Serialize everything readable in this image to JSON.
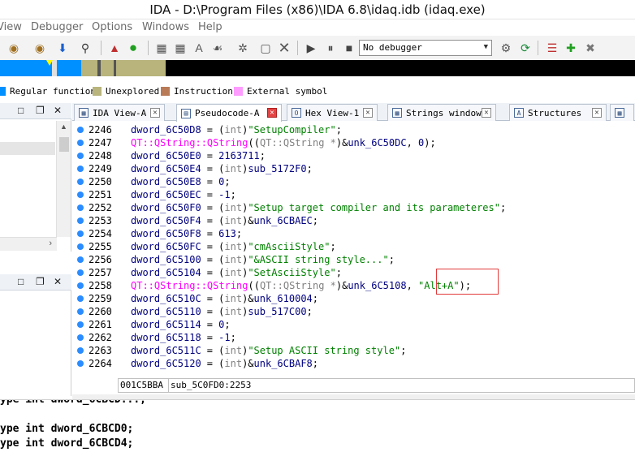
{
  "window": {
    "title": "IDA - D:\\Program Files (x86)\\IDA 6.8\\idaq.idb (idaq.exe)"
  },
  "menu": [
    "View",
    "Debugger",
    "Options",
    "Windows",
    "Help"
  ],
  "toolbar": {
    "debugger_select": "No debugger"
  },
  "legend": [
    {
      "label": "Regular function",
      "color": "#0090ff"
    },
    {
      "label": "Unexplored",
      "color": "#b8b47c"
    },
    {
      "label": "Instruction",
      "color": "#b97a57"
    },
    {
      "label": "External symbol",
      "color": "#ff9cff"
    }
  ],
  "tabs": [
    {
      "label": "IDA View-A",
      "icon": "ida-view-icon",
      "active": false
    },
    {
      "label": "Pseudocode-A",
      "icon": "pseudocode-icon",
      "active": true
    },
    {
      "label": "Hex View-1",
      "icon": "hex-view-icon",
      "active": false
    },
    {
      "label": "Strings window",
      "icon": "strings-icon",
      "active": false
    },
    {
      "label": "Structures",
      "icon": "structures-icon",
      "active": false
    }
  ],
  "code": {
    "lines": [
      {
        "n": "2246",
        "parts": [
          [
            "v",
            "dword_6C50D8"
          ],
          [
            "",
            "= ("
          ],
          [
            "kw",
            "int"
          ],
          [
            "",
            ")"
          ],
          [
            "str",
            "\"SetupCompiler\""
          ],
          [
            "",
            ";"
          ]
        ]
      },
      {
        "n": "2247",
        "parts": [
          [
            "fn",
            "QT::QString::QString"
          ],
          [
            "",
            "(("
          ],
          [
            "tp",
            "QT::QString *"
          ],
          [
            "",
            ")&"
          ],
          [
            "v",
            "unk_6C50DC"
          ],
          [
            "",
            ", "
          ],
          [
            "num",
            "0"
          ],
          [
            "",
            ");"
          ]
        ]
      },
      {
        "n": "2248",
        "parts": [
          [
            "v",
            "dword_6C50E0"
          ],
          [
            "",
            "= "
          ],
          [
            "num",
            "2163711"
          ],
          [
            "",
            ";"
          ]
        ]
      },
      {
        "n": "2249",
        "parts": [
          [
            "v",
            "dword_6C50E4"
          ],
          [
            "",
            "= ("
          ],
          [
            "kw",
            "int"
          ],
          [
            "",
            ")"
          ],
          [
            "v",
            "sub_5172F0"
          ],
          [
            "",
            ";"
          ]
        ]
      },
      {
        "n": "2250",
        "parts": [
          [
            "v",
            "dword_6C50E8"
          ],
          [
            "",
            "= "
          ],
          [
            "num",
            "0"
          ],
          [
            "",
            ";"
          ]
        ]
      },
      {
        "n": "2251",
        "parts": [
          [
            "v",
            "dword_6C50EC"
          ],
          [
            "",
            "= "
          ],
          [
            "num",
            "-1"
          ],
          [
            "",
            ";"
          ]
        ]
      },
      {
        "n": "2252",
        "parts": [
          [
            "v",
            "dword_6C50F0"
          ],
          [
            "",
            "= ("
          ],
          [
            "kw",
            "int"
          ],
          [
            "",
            ")"
          ],
          [
            "str",
            "\"Setup target compiler and its parameteres\""
          ],
          [
            "",
            ";"
          ]
        ]
      },
      {
        "n": "2253",
        "parts": [
          [
            "v",
            "dword_6C50F4"
          ],
          [
            "",
            "= ("
          ],
          [
            "kw",
            "int"
          ],
          [
            "",
            ")&"
          ],
          [
            "v",
            "unk_6CBAEC"
          ],
          [
            "",
            ";"
          ]
        ]
      },
      {
        "n": "2254",
        "parts": [
          [
            "v",
            "dword_6C50F8"
          ],
          [
            "",
            "= "
          ],
          [
            "num",
            "613"
          ],
          [
            "",
            ";"
          ]
        ]
      },
      {
        "n": "2255",
        "parts": [
          [
            "v",
            "dword_6C50FC"
          ],
          [
            "",
            "= ("
          ],
          [
            "kw",
            "int"
          ],
          [
            "",
            ")"
          ],
          [
            "str",
            "\"cmAsciiStyle\""
          ],
          [
            "",
            ";"
          ]
        ]
      },
      {
        "n": "2256",
        "parts": [
          [
            "v",
            "dword_6C5100"
          ],
          [
            "",
            "= ("
          ],
          [
            "kw",
            "int"
          ],
          [
            "",
            ")"
          ],
          [
            "str",
            "\"&ASCII string style...\""
          ],
          [
            "",
            ";"
          ]
        ]
      },
      {
        "n": "2257",
        "parts": [
          [
            "v",
            "dword_6C5104"
          ],
          [
            "",
            "= ("
          ],
          [
            "kw",
            "int"
          ],
          [
            "",
            ")"
          ],
          [
            "str",
            "\"SetAsciiStyle\""
          ],
          [
            "",
            ";"
          ]
        ]
      },
      {
        "n": "2258",
        "parts": [
          [
            "fn",
            "QT::QString::QString"
          ],
          [
            "",
            "(("
          ],
          [
            "tp",
            "QT::QString *"
          ],
          [
            "",
            ")&"
          ],
          [
            "v",
            "unk_6C5108"
          ],
          [
            "",
            ", "
          ],
          [
            "str",
            "\"Alt+A\""
          ],
          [
            "",
            ");"
          ]
        ]
      },
      {
        "n": "2259",
        "parts": [
          [
            "v",
            "dword_6C510C"
          ],
          [
            "",
            "= ("
          ],
          [
            "kw",
            "int"
          ],
          [
            "",
            ")&"
          ],
          [
            "v",
            "unk_610004"
          ],
          [
            "",
            ";"
          ]
        ]
      },
      {
        "n": "2260",
        "parts": [
          [
            "v",
            "dword_6C5110"
          ],
          [
            "",
            "= ("
          ],
          [
            "kw",
            "int"
          ],
          [
            "",
            ")"
          ],
          [
            "v",
            "sub_517C00"
          ],
          [
            "",
            ";"
          ]
        ]
      },
      {
        "n": "2261",
        "parts": [
          [
            "v",
            "dword_6C5114"
          ],
          [
            "",
            "= "
          ],
          [
            "num",
            "0"
          ],
          [
            "",
            ";"
          ]
        ]
      },
      {
        "n": "2262",
        "parts": [
          [
            "v",
            "dword_6C5118"
          ],
          [
            "",
            "= "
          ],
          [
            "num",
            "-1"
          ],
          [
            "",
            ";"
          ]
        ]
      },
      {
        "n": "2263",
        "parts": [
          [
            "v",
            "dword_6C511C"
          ],
          [
            "",
            "= ("
          ],
          [
            "kw",
            "int"
          ],
          [
            "",
            ")"
          ],
          [
            "str",
            "\"Setup ASCII string style\""
          ],
          [
            "",
            ";"
          ]
        ]
      },
      {
        "n": "2264",
        "parts": [
          [
            "v",
            "dword_6C5120"
          ],
          [
            "",
            "= ("
          ],
          [
            "kw",
            "int"
          ],
          [
            "",
            ")&"
          ],
          [
            "v",
            "unk_6CBAF8"
          ],
          [
            "",
            ";"
          ]
        ]
      }
    ]
  },
  "status": {
    "address": "001C5BBA",
    "function": "sub_5C0FD0:2253"
  },
  "output": [
    "ype int dword_6CBCD0;",
    "ype int dword_6CBCD4;"
  ]
}
